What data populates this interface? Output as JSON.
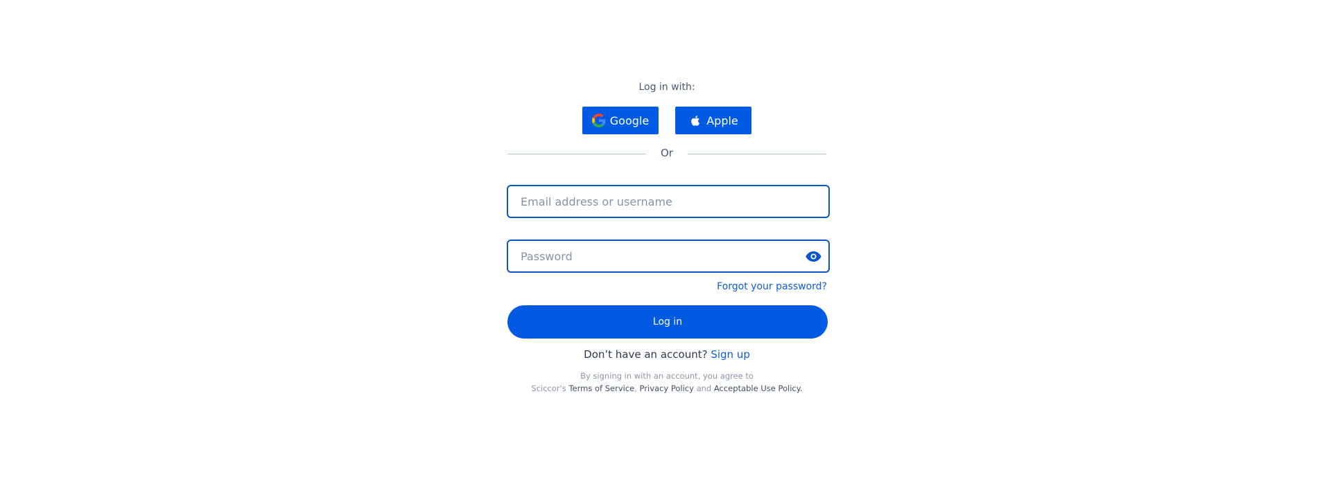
{
  "social": {
    "prompt": "Log in with:",
    "google_label": "Google",
    "apple_label": "Apple"
  },
  "divider": {
    "label": "Or"
  },
  "form": {
    "email_placeholder": "Email address or username",
    "email_value": "",
    "password_placeholder": "Password",
    "password_value": "",
    "forgot_label": "Forgot your password?",
    "submit_label": "Log in"
  },
  "signup": {
    "prompt": "Don’t have an account?",
    "link_label": "Sign up"
  },
  "legal": {
    "line1": "By signing in with  an account, you agree to",
    "prefix": "Sciccor's",
    "terms": "Terms of Service",
    "sep": ",",
    "privacy": "Privacy Policy",
    "and": "and",
    "aup": "Acceptable Use Policy."
  },
  "colors": {
    "primary": "#005be2",
    "field_border": "#0c55c9",
    "link": "#0f5dd6",
    "text": "#2a3a52",
    "muted": "#8a98ac",
    "divider": "#b5c0cf"
  },
  "icons": {
    "google": "google-icon",
    "apple": "apple-icon",
    "password_toggle": "eye-icon"
  }
}
